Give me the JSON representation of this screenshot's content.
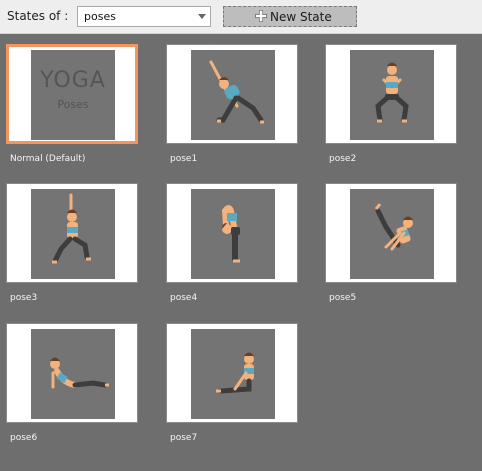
{
  "toolbar": {
    "states_label": "States of :",
    "select_value": "poses",
    "new_state_label": "New State"
  },
  "states": [
    {
      "name": "Normal (Default)",
      "selected": true,
      "thumb_title": "YOGA",
      "thumb_subtitle": "Poses"
    },
    {
      "name": "pose1",
      "pose": "triangle-pose"
    },
    {
      "name": "pose2",
      "pose": "goddess-squat-pose"
    },
    {
      "name": "pose3",
      "pose": "warrior-pose"
    },
    {
      "name": "pose4",
      "pose": "forward-fold-pose"
    },
    {
      "name": "pose5",
      "pose": "boat-pose"
    },
    {
      "name": "pose6",
      "pose": "cobra-pose"
    },
    {
      "name": "pose7",
      "pose": "seated-forward-pose"
    }
  ],
  "colors": {
    "accent": "#f2955f",
    "skin": "#f2b27d",
    "top": "#5aa9c4",
    "pants": "#3d3d3d",
    "hair": "#6b3e22",
    "thumb_bg": "#747474"
  }
}
